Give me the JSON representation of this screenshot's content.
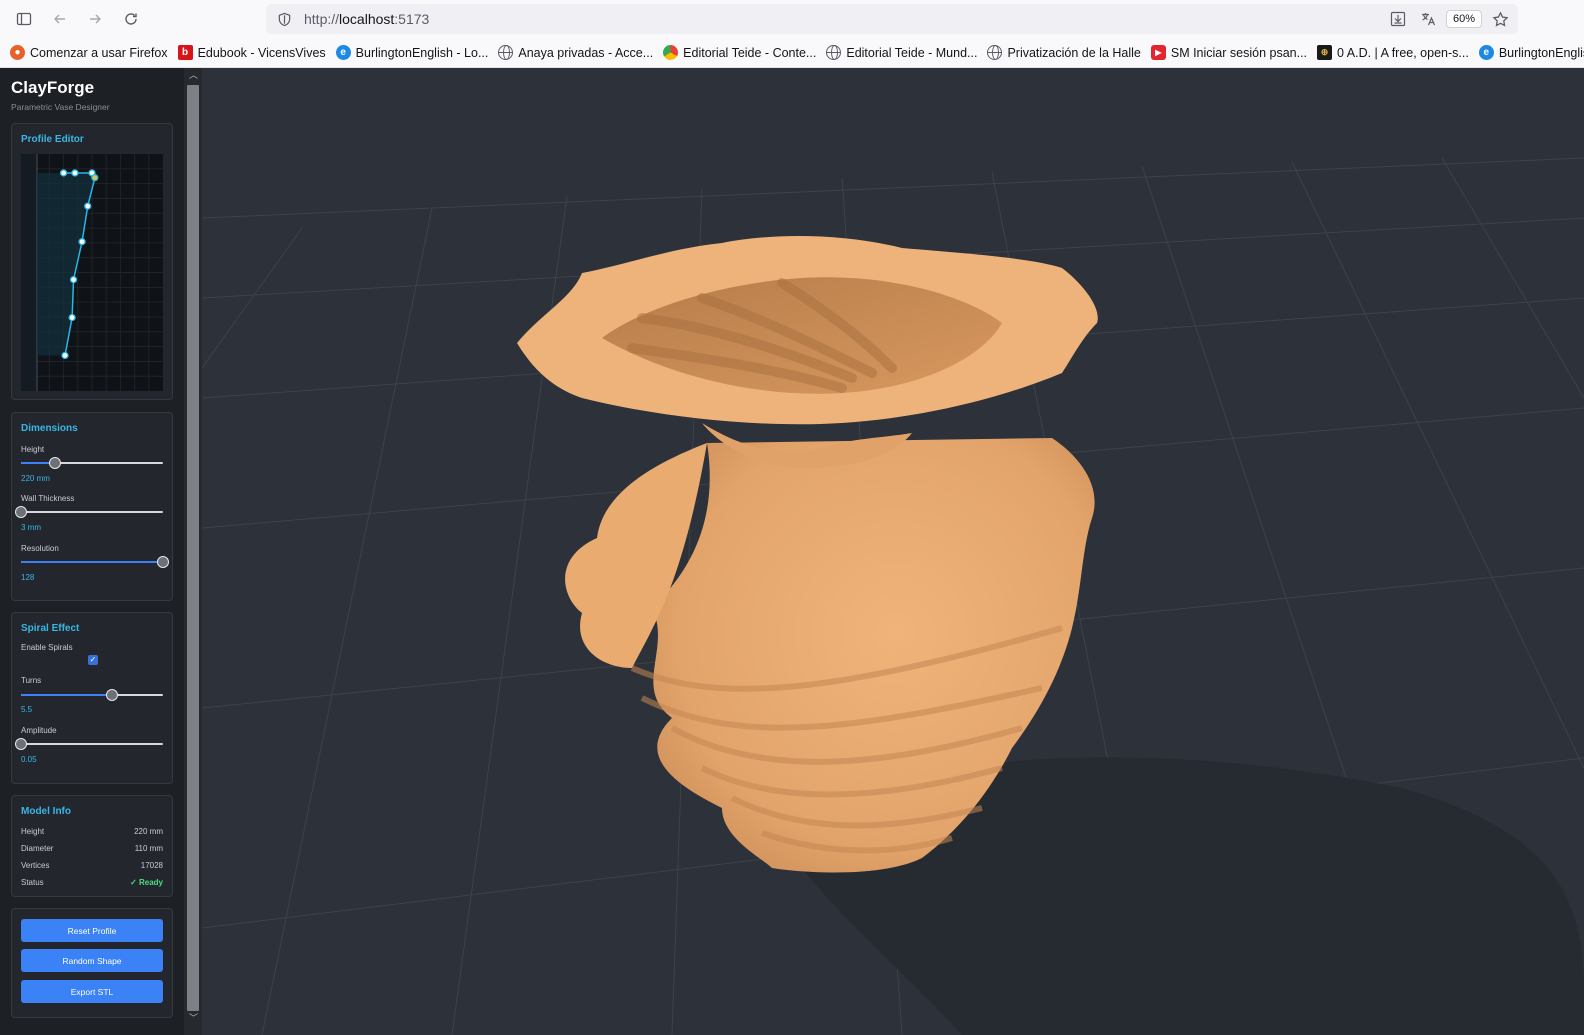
{
  "browser": {
    "url_scheme": "http://",
    "url_host": "localhost",
    "url_port": ":5173",
    "zoom": "60%",
    "bookmarks": [
      {
        "label": "Comenzar a usar Firefox",
        "icon": "firefox-icon",
        "color": "#e8602c"
      },
      {
        "label": "Edubook - VicensVives",
        "icon": "b-logo-icon",
        "color": "#d7141a"
      },
      {
        "label": "BurlingtonEnglish - Lo...",
        "icon": "burlington-icon",
        "color": "#1e88e5"
      },
      {
        "label": "Anaya privadas - Acce...",
        "icon": "globe-icon",
        "color": ""
      },
      {
        "label": "Editorial Teide - Conte...",
        "icon": "chrome-color-icon",
        "color": "#e94235"
      },
      {
        "label": "Editorial Teide - Mund...",
        "icon": "globe-icon",
        "color": ""
      },
      {
        "label": "Privatización de la Halle",
        "icon": "globe-icon",
        "color": ""
      },
      {
        "label": "SM Iniciar sesión psan...",
        "icon": "play-icon",
        "color": "#e3262d"
      },
      {
        "label": "0 A.D. | A free, open-s...",
        "icon": "0ad-icon",
        "color": "#1a1a1a"
      },
      {
        "label": "BurlingtonEnglish",
        "icon": "burlington-icon",
        "color": "#1e88e5"
      }
    ]
  },
  "app": {
    "title": "ClayForge",
    "subtitle": "Parametric Vase Designer",
    "accent": "#39b6e6",
    "button_color": "#3b82f6",
    "vase_color": "#e7a96e",
    "profile_editor": {
      "title": "Profile Editor",
      "points": [
        [
          0.3,
          0.08
        ],
        [
          0.38,
          0.08
        ],
        [
          0.5,
          0.08
        ],
        [
          0.52,
          0.1
        ],
        [
          0.47,
          0.22
        ],
        [
          0.43,
          0.37
        ],
        [
          0.37,
          0.53
        ],
        [
          0.36,
          0.69
        ],
        [
          0.31,
          0.85
        ]
      ]
    },
    "dimensions": {
      "title": "Dimensions",
      "height_label": "Height",
      "height_value": "220 mm",
      "height_frac": 0.24,
      "wall_label": "Wall Thickness",
      "wall_value": "3 mm",
      "wall_frac": 0.0,
      "resolution_label": "Resolution",
      "resolution_value": "128",
      "resolution_frac": 1.0
    },
    "spiral": {
      "title": "Spiral Effect",
      "enable_label": "Enable Spirals",
      "enabled_mark": "✓",
      "turns_label": "Turns",
      "turns_value": "5.5",
      "turns_frac": 0.64,
      "amplitude_label": "Amplitude",
      "amplitude_value": "0.05",
      "amplitude_frac": 0.0
    },
    "model_info": {
      "title": "Model Info",
      "rows": [
        {
          "label": "Height",
          "value": "220 mm"
        },
        {
          "label": "Diameter",
          "value": "110 mm"
        },
        {
          "label": "Vertices",
          "value": "17028"
        },
        {
          "label": "Status",
          "value": "✓ Ready"
        }
      ]
    },
    "actions": {
      "reset": "Reset Profile",
      "random": "Random Shape",
      "export": "Export STL"
    }
  }
}
